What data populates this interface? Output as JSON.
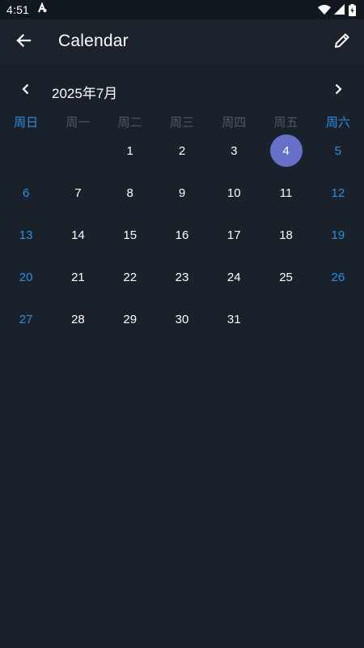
{
  "status_bar": {
    "time": "4:51",
    "icons": [
      "accessibility-icon",
      "wifi-icon",
      "signal-icon",
      "battery-charging-icon"
    ]
  },
  "app_bar": {
    "title": "Calendar",
    "back_icon": "arrow-left-icon",
    "edit_icon": "pencil-icon"
  },
  "month_nav": {
    "label": "2025年7月",
    "prev_icon": "chevron-left-icon",
    "next_icon": "chevron-right-icon"
  },
  "weekdays": [
    "周日",
    "周一",
    "周二",
    "周三",
    "周四",
    "周五",
    "周六"
  ],
  "weeks": [
    [
      "",
      "",
      "1",
      "2",
      "3",
      "4",
      "5"
    ],
    [
      "6",
      "7",
      "8",
      "9",
      "10",
      "11",
      "12"
    ],
    [
      "13",
      "14",
      "15",
      "16",
      "17",
      "18",
      "19"
    ],
    [
      "20",
      "21",
      "22",
      "23",
      "24",
      "25",
      "26"
    ],
    [
      "27",
      "28",
      "29",
      "30",
      "31",
      "",
      ""
    ]
  ],
  "selected_day": "4",
  "colors": {
    "background": "#1a212b",
    "app_bar": "#1c232d",
    "weekend": "#2e8de0",
    "weekday_header": "#4f5864",
    "selected": "#6670c8"
  }
}
